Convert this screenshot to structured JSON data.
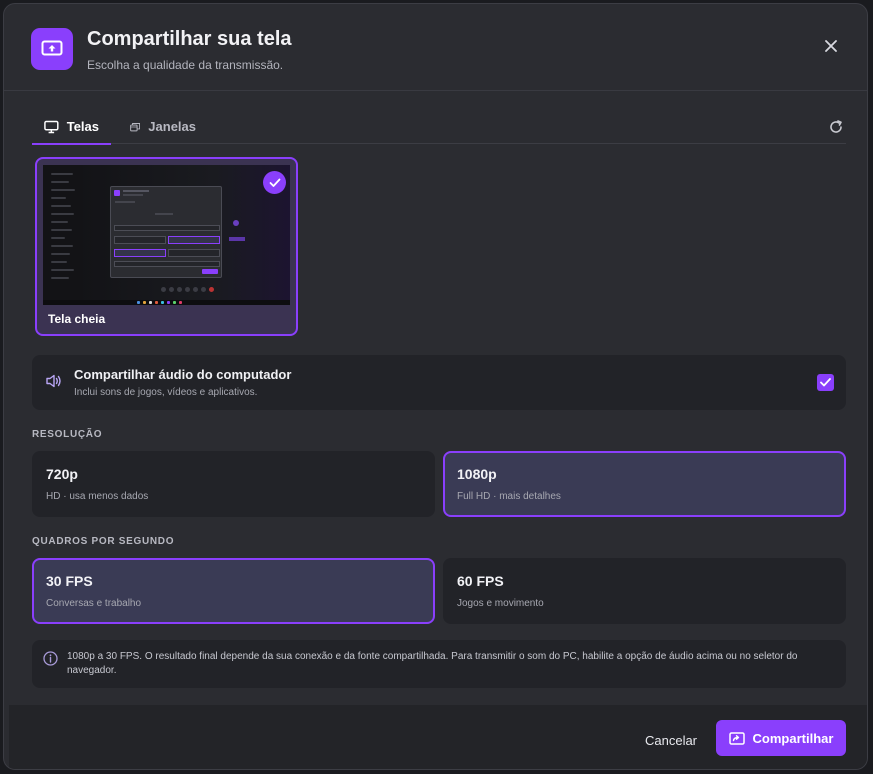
{
  "header": {
    "title": "Compartilhar sua tela",
    "subtitle": "Escolha a qualidade da transmissão.",
    "icon": "screen-share-icon"
  },
  "tabs": [
    {
      "label": "Telas",
      "icon": "monitor-icon",
      "active": true
    },
    {
      "label": "Janelas",
      "icon": "windows-icon",
      "active": false
    }
  ],
  "screens": [
    {
      "label": "Tela cheia",
      "selected": true
    }
  ],
  "audio": {
    "title": "Compartilhar áudio do computador",
    "description": "Inclui sons de jogos, vídeos e aplicativos.",
    "checked": true
  },
  "resolution": {
    "label": "RESOLUÇÃO",
    "options": [
      {
        "title": "720p",
        "desc": "HD · usa menos dados",
        "selected": false
      },
      {
        "title": "1080p",
        "desc": "Full HD · mais detalhes",
        "selected": true
      }
    ]
  },
  "fps": {
    "label": "QUADROS POR SEGUNDO",
    "options": [
      {
        "title": "30 FPS",
        "desc": "Conversas e trabalho",
        "selected": true
      },
      {
        "title": "60 FPS",
        "desc": "Jogos e movimento",
        "selected": false
      }
    ]
  },
  "info": {
    "text": "1080p a 30 FPS. O resultado final depende da sua conexão e da fonte compartilhada. Para transmitir o som do PC, habilite a opção de áudio acima ou no seletor do navegador."
  },
  "footer": {
    "cancel_label": "Cancelar",
    "share_label": "Compartilhar"
  },
  "colors": {
    "accent": "#8a3ffc",
    "background": "#2b2c31",
    "card": "#222328",
    "selected_card": "#3a3b55"
  }
}
